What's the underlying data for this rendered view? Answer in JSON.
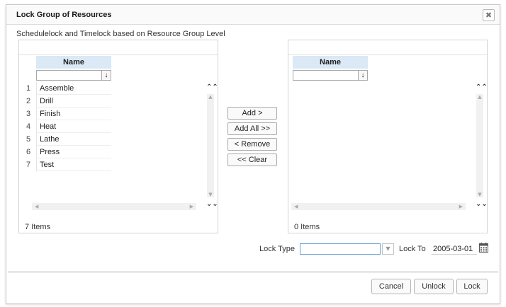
{
  "dialog": {
    "title": "Lock Group of Resources",
    "close_symbol": "✖",
    "subtitle": "Schedulelock and Timelock based on Resource Group Level"
  },
  "left_list": {
    "column_header": "Name",
    "filter_drop_symbol": "↓",
    "rows": [
      {
        "num": "1",
        "name": "Assemble"
      },
      {
        "num": "2",
        "name": "Drill"
      },
      {
        "num": "3",
        "name": "Finish"
      },
      {
        "num": "4",
        "name": "Heat"
      },
      {
        "num": "5",
        "name": "Lathe"
      },
      {
        "num": "6",
        "name": "Press"
      },
      {
        "num": "7",
        "name": "Test"
      }
    ],
    "count": "7 Items"
  },
  "right_list": {
    "column_header": "Name",
    "filter_drop_symbol": "↓",
    "rows": [],
    "count": "0 Items"
  },
  "transfer_buttons": {
    "add": "Add >",
    "add_all": "Add All >>",
    "remove": "< Remove",
    "clear": "<< Clear"
  },
  "scroll_glyphs": {
    "top": "⌃⌃",
    "bottom": "⌄⌄",
    "up": "▲",
    "down": "▼",
    "left": "◀",
    "right": "▶"
  },
  "lock_options": {
    "lock_type_label": "Lock Type",
    "lock_type_value": "",
    "lock_to_label": "Lock To",
    "lock_to_value": "2005-03-01",
    "combo_drop_symbol": "▼"
  },
  "footer": {
    "cancel": "Cancel",
    "unlock": "Unlock",
    "lock": "Lock"
  },
  "colors": {
    "header_bg": "#dbe8f5",
    "focus_border": "#6aa1d8"
  },
  "icons": [
    "close-icon",
    "dropdown-arrow-icon",
    "scroll-top-icon",
    "scroll-bottom-icon",
    "calendar-icon"
  ]
}
